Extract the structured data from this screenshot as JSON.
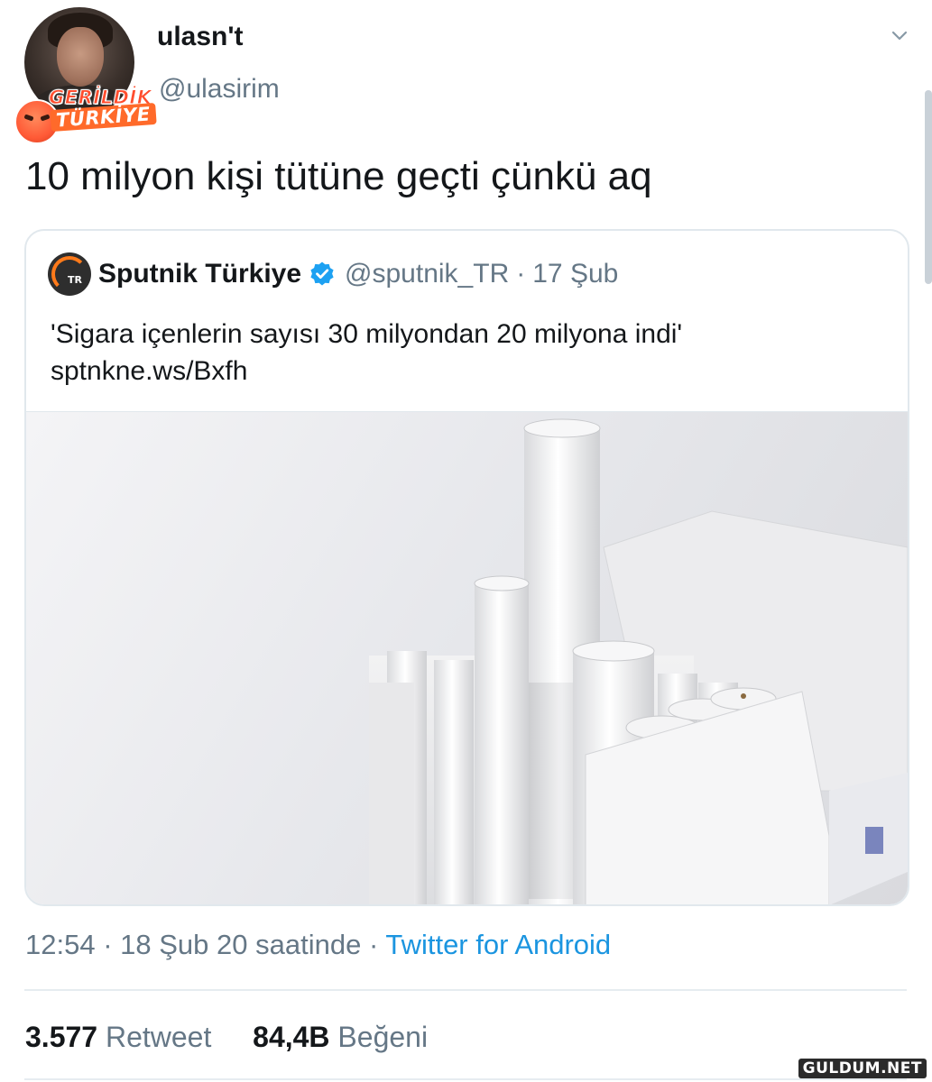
{
  "author": {
    "display_name": "ulasn't",
    "handle": "@ulasirim",
    "avatar_badge_line1": "GERİLDİK",
    "avatar_badge_line2": "TÜRKİYE"
  },
  "tweet": {
    "text": "10 milyon kişi tütüne geçti çünkü aq"
  },
  "quoted_tweet": {
    "name": "Sputnik Türkiye",
    "handle": "@sputnik_TR",
    "separator": "·",
    "date": "17 Şub",
    "text_line1": "'Sigara içenlerin sayısı 30 milyondan 20 milyona indi'",
    "text_line2": "sptnkne.ws/Bxfh",
    "avatar_label": "TR",
    "image_icon": "cigarettes-photo"
  },
  "meta": {
    "time": "12:54",
    "separator": "·",
    "date": "18 Şub 20 saatinde",
    "source": "Twitter for Android"
  },
  "stats": {
    "retweets_count": "3.577",
    "retweets_label": "Retweet",
    "likes_count": "84,4B",
    "likes_label": "Beğeni"
  },
  "watermark": "GULDUM.NET",
  "colors": {
    "link_blue": "#1b95e0",
    "secondary_gray": "#657786",
    "verified_blue": "#1da1f2"
  }
}
